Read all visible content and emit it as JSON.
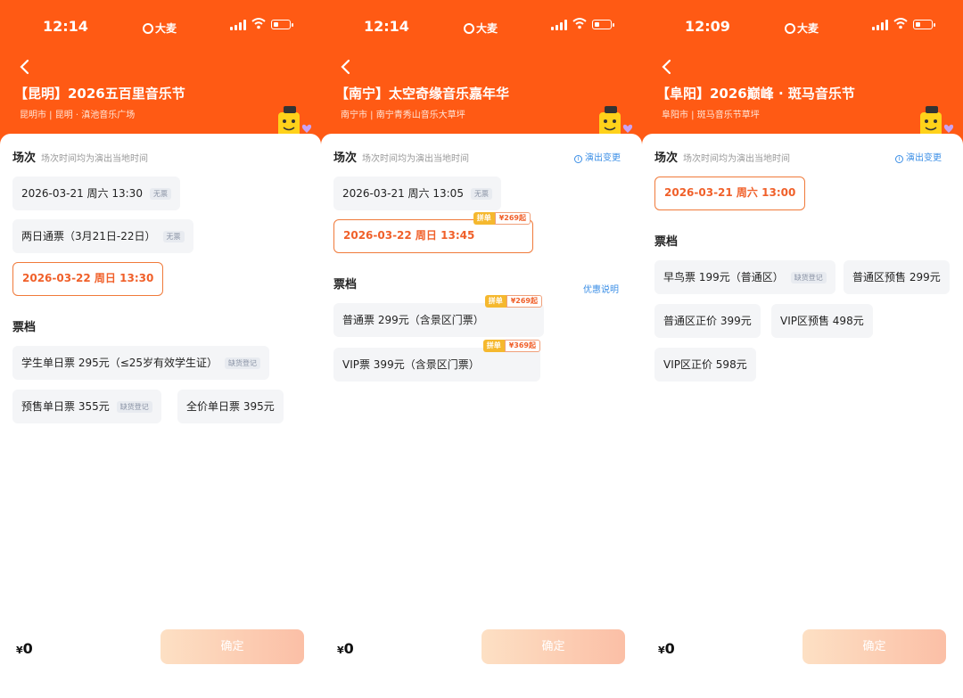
{
  "panels": [
    {
      "status": {
        "time": "12:14",
        "carrier": "大麦"
      },
      "header": {
        "title": "【昆明】2026五百里音乐节",
        "subtitle": "昆明市 | 昆明 · 滇池音乐广场"
      },
      "sessions": {
        "label": "场次",
        "hint": "场次时间均为演出当地时间",
        "link": "",
        "items": [
          {
            "text": "2026-03-21 周六 13:30",
            "tag": "无票",
            "selected": false
          },
          {
            "text": "两日通票（3月21日-22日）",
            "tag": "无票",
            "selected": false
          },
          {
            "text": "2026-03-22 周日 13:30",
            "tag": "",
            "selected": true
          }
        ]
      },
      "tickets": {
        "label": "票档",
        "link": "",
        "items": [
          {
            "text": "学生单日票 295元（≤25岁有效学生证）",
            "tag": "缺货登记"
          },
          {
            "text": "预售单日票 355元",
            "tag": "缺货登记"
          },
          {
            "text": "全价单日票 395元",
            "tag": ""
          }
        ]
      },
      "footer": {
        "currency": "¥",
        "amount": "0",
        "confirm": "确定"
      }
    },
    {
      "status": {
        "time": "12:14",
        "carrier": "大麦"
      },
      "header": {
        "title": "【南宁】太空奇缘音乐嘉年华",
        "subtitle": "南宁市 | 南宁青秀山音乐大草坪"
      },
      "sessions": {
        "label": "场次",
        "hint": "场次时间均为演出当地时间",
        "link": "演出变更",
        "items": [
          {
            "text": "2026-03-21 周六 13:05",
            "tag": "无票",
            "selected": false
          },
          {
            "text": "2026-03-22 周日 13:45",
            "tag": "",
            "selected": true,
            "promo_a": "拼单",
            "promo_b": "¥269起"
          }
        ]
      },
      "tickets": {
        "label": "票档",
        "link": "优惠说明",
        "items": [
          {
            "text": "普通票 299元（含景区门票）",
            "tag": "",
            "promo_a": "拼单",
            "promo_b": "¥269起"
          },
          {
            "text": "VIP票 399元（含景区门票）",
            "tag": "",
            "promo_a": "拼单",
            "promo_b": "¥369起"
          }
        ]
      },
      "footer": {
        "currency": "¥",
        "amount": "0",
        "confirm": "确定"
      }
    },
    {
      "status": {
        "time": "12:09",
        "carrier": "大麦"
      },
      "header": {
        "title": "【阜阳】2026巅峰 · 斑马音乐节",
        "subtitle": "阜阳市 | 斑马音乐节草坪"
      },
      "sessions": {
        "label": "场次",
        "hint": "场次时间均为演出当地时间",
        "link": "演出变更",
        "items": [
          {
            "text": "2026-03-21 周六 13:00",
            "tag": "",
            "selected": true
          }
        ]
      },
      "tickets": {
        "label": "票档",
        "link": "",
        "items": [
          {
            "text": "早鸟票 199元（普通区）",
            "tag": "缺货登记"
          },
          {
            "text": "普通区预售 299元",
            "tag": ""
          },
          {
            "text": "普通区正价 399元",
            "tag": ""
          },
          {
            "text": "VIP区预售 498元",
            "tag": ""
          },
          {
            "text": "VIP区正价 598元",
            "tag": ""
          }
        ]
      },
      "footer": {
        "currency": "¥",
        "amount": "0",
        "confirm": "确定"
      }
    }
  ],
  "colors": {
    "header": "#ff5a14",
    "accent": "#f0602a",
    "link": "#3a8ee6",
    "chip": "#f4f5f7"
  }
}
